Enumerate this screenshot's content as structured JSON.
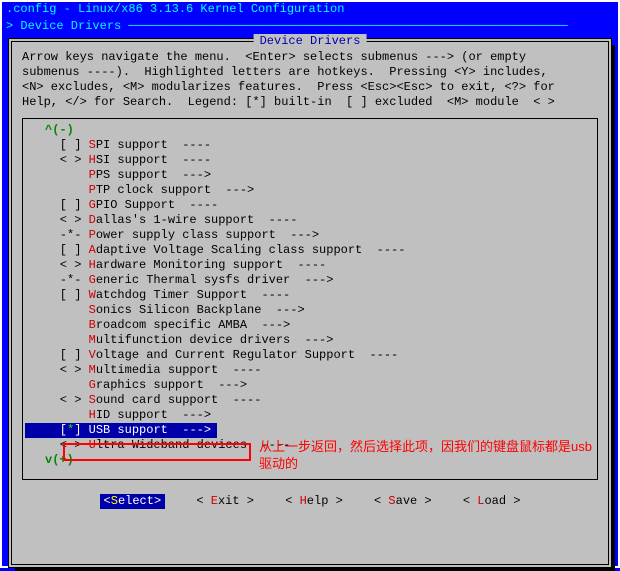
{
  "window": {
    "title": ".config - Linux/x86 3.13.6 Kernel Configuration",
    "breadcrumb": "> Device Drivers ─────────────────────────────────────────────────────────────"
  },
  "panel": {
    "title": " Device Drivers ",
    "help": "Arrow keys navigate the menu.  <Enter> selects submenus ---> (or empty\nsubmenus ----).  Highlighted letters are hotkeys.  Pressing <Y> includes,\n<N> excludes, <M> modularizes features.  Press <Esc><Esc> to exit, <?> for\nHelp, </> for Search.  Legend: [*] built-in  [ ] excluded  <M> module  < >"
  },
  "scroll": {
    "up": "^(-)",
    "down": "v(+)"
  },
  "items": [
    {
      "prefix": "[ ] ",
      "hot": "S",
      "rest": "PI support  ----"
    },
    {
      "prefix": "< > ",
      "hot": "H",
      "rest": "SI support  ----"
    },
    {
      "prefix": "    ",
      "hot": "P",
      "rest": "PS support  --->"
    },
    {
      "prefix": "    ",
      "hot": "P",
      "rest": "TP clock support  --->"
    },
    {
      "prefix": "[ ] ",
      "hot": "G",
      "rest": "PIO Support  ----"
    },
    {
      "prefix": "< > ",
      "hot": "D",
      "rest": "allas's 1-wire support  ----"
    },
    {
      "prefix": "-*- ",
      "hot": "P",
      "rest": "ower supply class support  --->"
    },
    {
      "prefix": "[ ] ",
      "hot": "A",
      "rest": "daptive Voltage Scaling class support  ----"
    },
    {
      "prefix": "< > ",
      "hot": "H",
      "rest": "ardware Monitoring support  ----"
    },
    {
      "prefix": "-*- ",
      "hot": "G",
      "rest": "eneric Thermal sysfs driver  --->"
    },
    {
      "prefix": "[ ] ",
      "hot": "W",
      "rest": "atchdog Timer Support  ----"
    },
    {
      "prefix": "    ",
      "hot": "S",
      "rest": "onics Silicon Backplane  --->"
    },
    {
      "prefix": "    ",
      "hot": "B",
      "rest": "roadcom specific AMBA  --->"
    },
    {
      "prefix": "    ",
      "hot": "M",
      "rest": "ultifunction device drivers  --->"
    },
    {
      "prefix": "[ ] ",
      "hot": "V",
      "rest": "oltage and Current Regulator Support  ----"
    },
    {
      "prefix": "< > ",
      "hot": "M",
      "rest": "ultimedia support  ----"
    },
    {
      "prefix": "    ",
      "hot": "G",
      "rest": "raphics support  --->"
    },
    {
      "prefix": "< > ",
      "hot": "S",
      "rest": "ound card support  ----"
    },
    {
      "prefix": "    ",
      "hot": "H",
      "rest": "ID support  --->"
    },
    {
      "prefix": "[*] ",
      "hot": "U",
      "rest": "SB support  --->",
      "selected": true
    },
    {
      "prefix": "< > ",
      "hot": "U",
      "rest": "ltra Wideband devices  ----"
    }
  ],
  "annotation": "从上一步返回，然后选择此项，因我们的键盘鼠标都是usb驱动的",
  "buttons": {
    "select": {
      "hot": "S",
      "rest": "elect",
      "wrap": true
    },
    "exit": {
      "hot": "E",
      "rest": "xit"
    },
    "help": {
      "hot": "H",
      "rest": "elp"
    },
    "save": {
      "hot": "S",
      "rest": "ave"
    },
    "load": {
      "hot": "L",
      "rest": "oad"
    }
  }
}
